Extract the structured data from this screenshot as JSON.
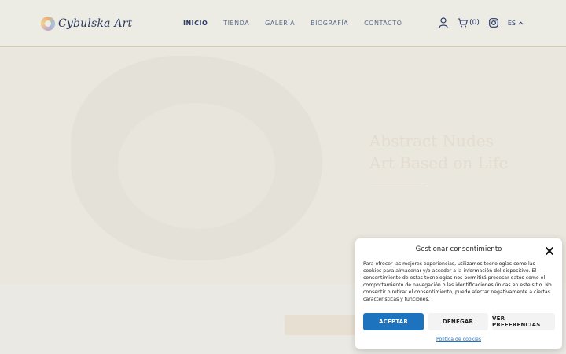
{
  "header": {
    "logo_text": "Cybulska Art",
    "nav": [
      {
        "label": "INICIO",
        "active": true
      },
      {
        "label": "TIENDA",
        "active": false
      },
      {
        "label": "GALERÍA",
        "active": false
      },
      {
        "label": "BIOGRAFÍA",
        "active": false
      },
      {
        "label": "CONTACTO",
        "active": false
      }
    ],
    "cart_count": "(0)",
    "language": "ES",
    "icons": [
      "user-icon",
      "cart-icon",
      "instagram-icon",
      "chevron-up-icon"
    ]
  },
  "hero": {
    "title": "Abstract Nudes\nArt Based on Life"
  },
  "consent": {
    "title": "Gestionar consentimiento",
    "body": "Para ofrecer las mejores experiencias, utilizamos tecnologías como las cookies para almacenar y/o acceder a la información del dispositivo. El consentimiento de estas tecnologías nos permitirá procesar datos como el comportamiento de navegación o las identificaciones únicas en este sitio. No consentir o retirar el consentimiento, puede afectar negativamente a ciertas características y funciones.",
    "accept_label": "ACEPTAR",
    "deny_label": "DENEGAR",
    "prefs_label": "VER PREFERENCIAS",
    "policy_link": "Política de cookies"
  },
  "colors": {
    "accent": "#1e73be",
    "nav_text": "#2a3a6e",
    "background": "#ecebe4"
  }
}
